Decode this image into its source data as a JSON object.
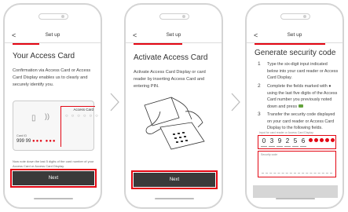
{
  "colors": {
    "accent": "#e30613",
    "button": "#3a3a3a",
    "ok": "#63a33d"
  },
  "screens": [
    {
      "header": {
        "back": "<",
        "title": "Set up"
      },
      "heading": "Your Access Card",
      "body": "Confirmation via Access Card or Access Card Display enables us to clearly and securely identify you.",
      "card": {
        "label": "Access Card",
        "number_label": "Card ID",
        "number_prefix": "999 99",
        "number_masked": "●●● ●●●"
      },
      "note": "Now note down the last 5 digits of the card number of your Access Card or Access Card Display.",
      "button": "Next"
    },
    {
      "header": {
        "back": "<",
        "title": "Set up"
      },
      "heading": "Activate Access Card",
      "body": "Activate Access Card Display or card reader by inserting Access Card and entering PIN.",
      "button": "Next"
    },
    {
      "header": {
        "back": "<",
        "title": "Set up"
      },
      "heading": "Generate security code",
      "steps": [
        {
          "n": "1",
          "text": "Type the six-digit input indicated below into your card reader or Access Card Display."
        },
        {
          "n": "2",
          "text": "Complete the fields marked with ● using the last five digits of the Access Card number you previously noted down and press"
        },
        {
          "n": "3",
          "text": "Transfer the security code displayed on your card reader or Access Card Display to the following fields."
        }
      ],
      "input_label": "Input for card reader or Access Card Display",
      "digits": [
        "0",
        "3",
        "9",
        "2",
        "5",
        "6"
      ],
      "security_label": "Security code"
    }
  ]
}
